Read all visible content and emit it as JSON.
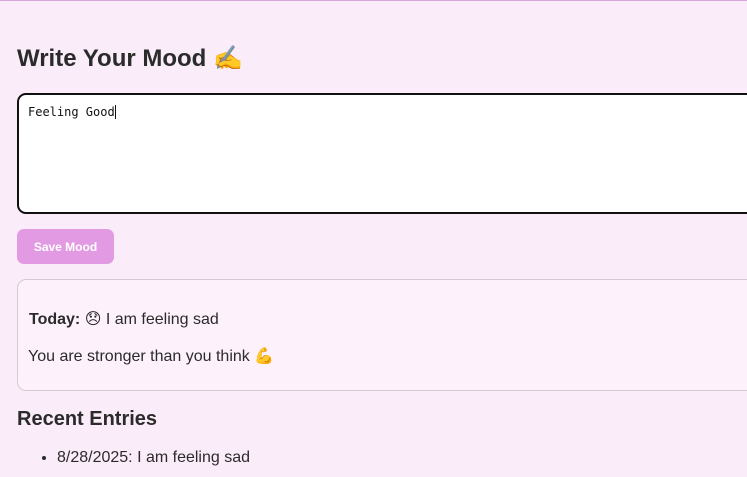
{
  "header": {
    "title": "Write Your Mood",
    "title_emoji": "✍️"
  },
  "mood_input": {
    "value": "Feeling Good"
  },
  "save_button": {
    "label": "Save Mood",
    "color": "#e29be3"
  },
  "today_card": {
    "label": "Today:",
    "emoji": "😞",
    "mood_text": "I am feeling sad",
    "quote": "You are stronger than you think",
    "quote_emoji": "💪"
  },
  "recent": {
    "heading": "Recent Entries",
    "entries": [
      {
        "text": "8/28/2025: I am feeling sad"
      }
    ]
  },
  "colors": {
    "background": "#fbecf9",
    "card_background": "#fdf1fc"
  }
}
